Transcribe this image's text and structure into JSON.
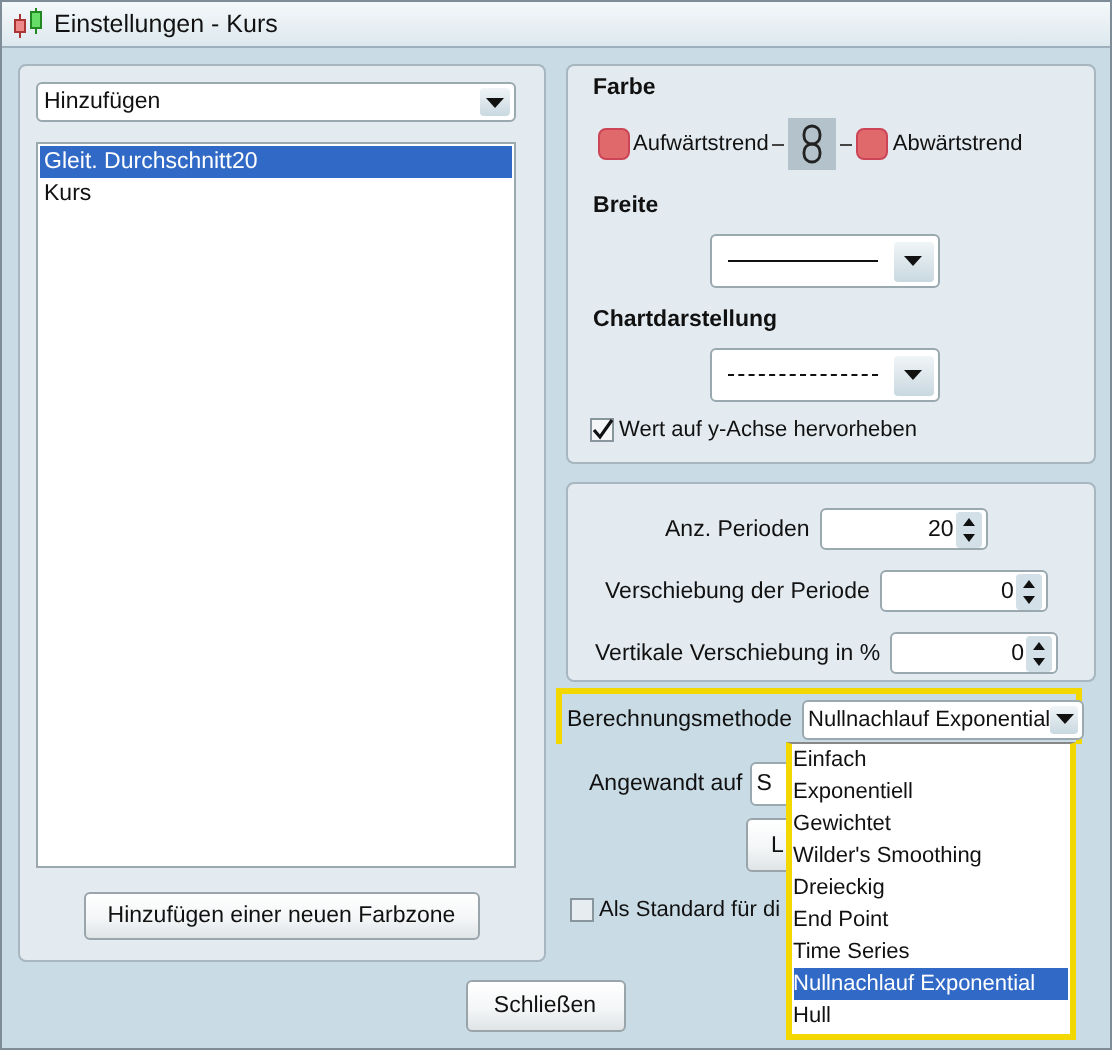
{
  "window": {
    "title": "Einstellungen - Kurs"
  },
  "left": {
    "add_dropdown": {
      "value": "Hinzufügen"
    },
    "items": [
      {
        "label": "Gleit. Durchschnitt20",
        "selected": true
      },
      {
        "label": "Kurs",
        "selected": false
      }
    ],
    "add_zone_button": "Hinzufügen einer neuen Farbzone"
  },
  "appearance": {
    "color_heading": "Farbe",
    "up_label": "Aufwärtstrend",
    "down_label": "Abwärtstrend",
    "width_heading": "Breite",
    "style_heading": "Chartdarstellung",
    "width_preview": {
      "kind": "solid"
    },
    "style_preview": {
      "kind": "dashed"
    },
    "highlight": {
      "label": "Wert auf y-Achse hervorheben",
      "checked": true
    }
  },
  "periods": [
    {
      "label": "Anz. Perioden",
      "value": "20"
    },
    {
      "label": "Verschiebung der Periode",
      "value": "0"
    },
    {
      "label": "Vertikale Verschiebung in %",
      "value": "0"
    }
  ],
  "method": {
    "label": "Berechnungsmethode",
    "value": "Nullnachlauf Exponential",
    "options": [
      {
        "label": "Einfach",
        "selected": false
      },
      {
        "label": "Exponentiell",
        "selected": false
      },
      {
        "label": "Gewichtet",
        "selected": false
      },
      {
        "label": "Wilder's Smoothing",
        "selected": false
      },
      {
        "label": "Dreieckig",
        "selected": false
      },
      {
        "label": "End Point",
        "selected": false
      },
      {
        "label": "Time Series",
        "selected": false
      },
      {
        "label": "Nullnachlauf Exponential",
        "selected": true
      },
      {
        "label": "Hull",
        "selected": false
      }
    ]
  },
  "applied_to": {
    "label": "Angewandt auf",
    "value": "S"
  },
  "partial_button": "L",
  "default_checkbox": {
    "label": "Als Standard für di",
    "checked": false
  },
  "close_button": "Schließen"
}
